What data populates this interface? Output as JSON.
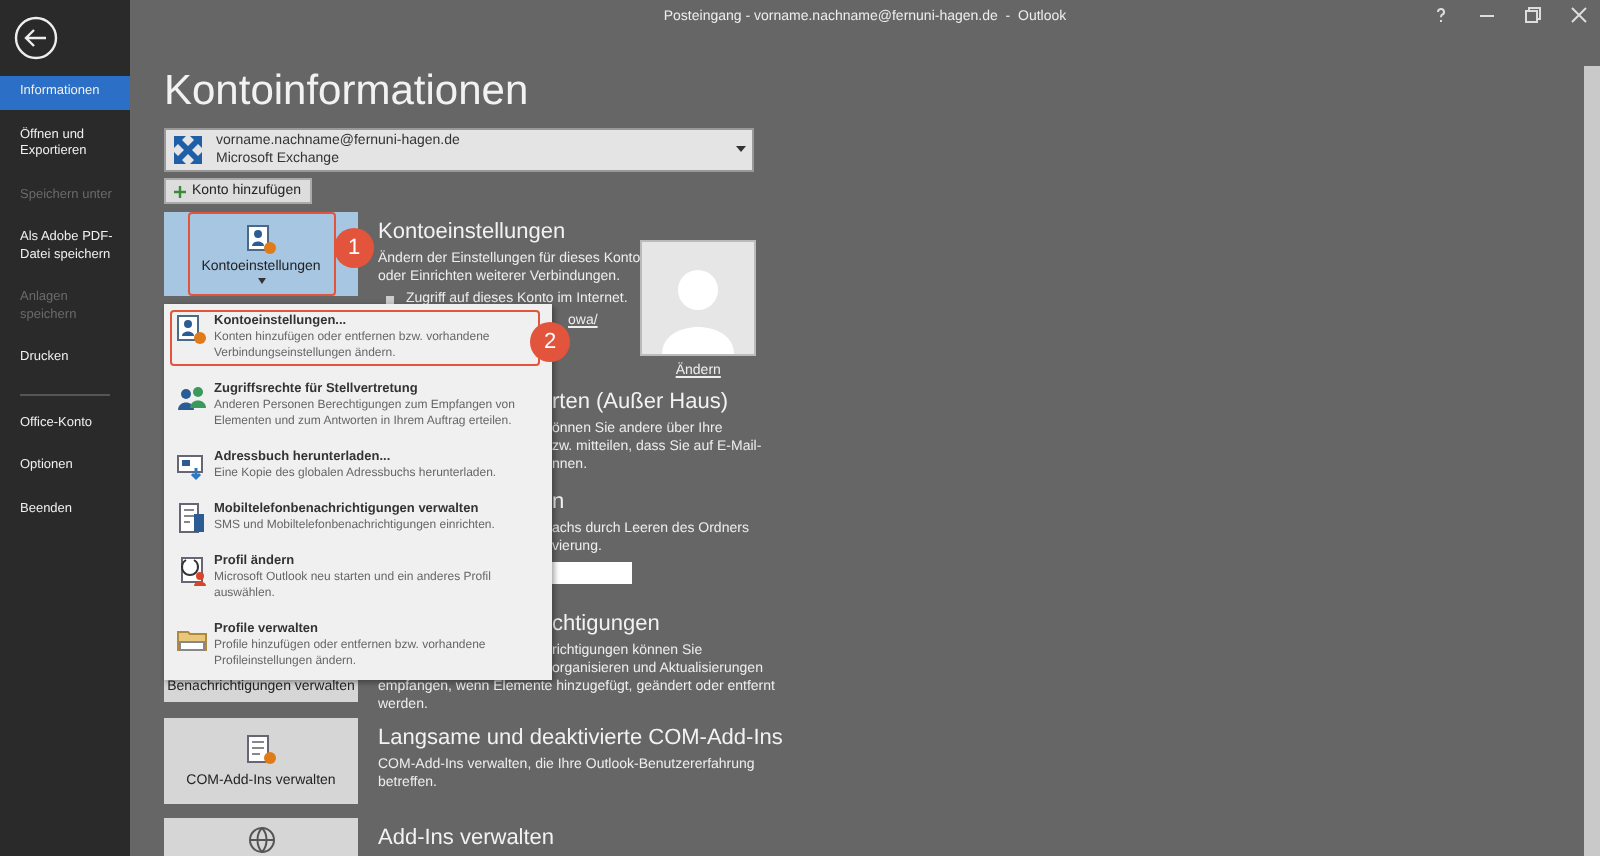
{
  "window": {
    "title": "Posteingang - vorname.nachname@fernuni-hagen.de  -  Outlook"
  },
  "sidebar": {
    "items": [
      {
        "label": "Informationen",
        "selected": true,
        "disabled": false
      },
      {
        "label": "Öffnen und Exportieren",
        "selected": false,
        "disabled": false
      },
      {
        "label": "Speichern unter",
        "selected": false,
        "disabled": true
      },
      {
        "label": "Als Adobe PDF-Datei speichern",
        "selected": false,
        "disabled": false
      },
      {
        "label": "Anlagen speichern",
        "selected": false,
        "disabled": true
      },
      {
        "label": "Drucken",
        "selected": false,
        "disabled": false
      }
    ],
    "account_items": [
      {
        "label": "Office-Konto",
        "selected": false,
        "disabled": false
      },
      {
        "label": "Optionen",
        "selected": false,
        "disabled": false
      },
      {
        "label": "Beenden",
        "selected": false,
        "disabled": false
      }
    ]
  },
  "page_title": "Kontoinformationen",
  "account": {
    "email": "vorname.nachname@fernuni-hagen.de",
    "type": "Microsoft Exchange"
  },
  "add_account_button": "Konto hinzufügen",
  "account_settings": {
    "button": "Kontoeinstellungen",
    "selected": true,
    "heading": "Kontoeinstellungen",
    "lines": [
      "Ändern der Einstellungen für dieses Konto",
      "oder Einrichten weiterer Verbindungen."
    ],
    "bullet": "Zugriff auf dieses Konto im Internet.",
    "link": "owa/",
    "photo_link": "Ändern"
  },
  "callouts": [
    "1",
    "2"
  ],
  "menu": {
    "items": [
      {
        "title": "Kontoeinstellungen...",
        "description": "Konten hinzufügen oder entfernen bzw. vorhandene\nVerbindungseinstellungen ändern.",
        "selected": true
      },
      {
        "title": "Zugriffsrechte für Stellvertretung",
        "description": "Anderen Personen Berechtigungen zum Empfangen von\nElementen und zum Antworten in Ihrem Auftrag erteilen.",
        "selected": false
      },
      {
        "title": "Adressbuch herunterladen...",
        "description": "Eine Kopie des globalen Adressbuchs herunterladen.",
        "selected": false
      },
      {
        "title": "Mobiltelefonbenachrichtigungen verwalten",
        "description": "SMS und Mobiltelefonbenachrichtigungen einrichten.",
        "selected": false
      },
      {
        "title": "Profil ändern",
        "description": "Microsoft Outlook neu starten und ein anderes Profil\nauswählen.",
        "selected": false
      },
      {
        "title": "Profile verwalten",
        "description": "Profile hinzufügen oder entfernen bzw. vorhandene\nProfileinstellungen ändern.",
        "selected": false
      }
    ]
  },
  "auto_reply": {
    "heading": "rten (Außer Haus)",
    "lines": [
      "önnen Sie andere über Ihre",
      "zw. mitteilen, dass Sie auf E-Mail-",
      "nnen."
    ]
  },
  "mailbox": {
    "heading": "n",
    "lines": [
      "achs durch Leeren des Ordners",
      "vierung."
    ]
  },
  "rules": {
    "heading": "chtigungen",
    "covered_lines": [
      "richtigungen können Sie",
      "organisieren und Aktualisierungen"
    ],
    "lines": [
      "empfangen, wenn Elemente hinzugefügt, geändert oder entfernt",
      "werden."
    ],
    "button": "Benachrichtigungen verwalten"
  },
  "com_addins": {
    "button": "COM-Add-Ins verwalten",
    "heading": "Langsame und deaktivierte COM-Add-Ins",
    "description": "COM-Add-Ins verwalten, die Ihre Outlook-Benutzererfahrung betreffen."
  },
  "addins": {
    "heading": "Add-Ins verwalten"
  }
}
